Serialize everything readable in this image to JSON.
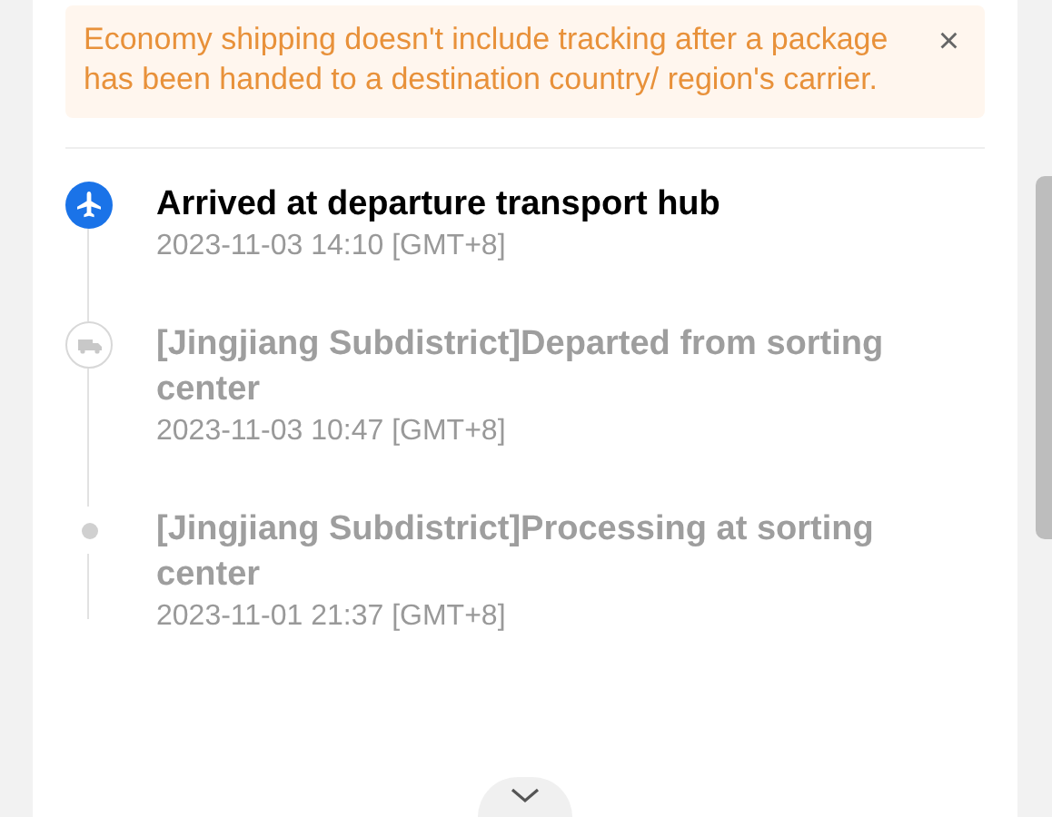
{
  "notice": {
    "text": "Economy shipping doesn't include tracking after a package has been handed to a destination country/ region's carrier.",
    "close": "×"
  },
  "events": [
    {
      "kind": "plane",
      "current": true,
      "title": "Arrived at departure transport hub",
      "time": "2023-11-03 14:10 [GMT+8]"
    },
    {
      "kind": "truck",
      "current": false,
      "title": "[Jingjiang Subdistrict]Departed from sorting center",
      "time": "2023-11-03 10:47 [GMT+8]"
    },
    {
      "kind": "dot",
      "current": false,
      "title": "[Jingjiang Subdistrict]Processing at sorting center",
      "time": "2023-11-01 21:37 [GMT+8]"
    }
  ]
}
